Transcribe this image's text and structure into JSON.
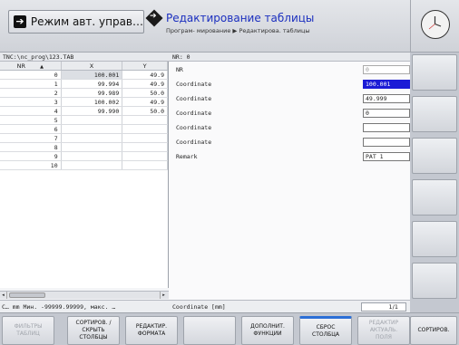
{
  "header": {
    "mode_title": "Режим авт. управ…",
    "edit_title": "Редактирование таблицы",
    "edit_breadcrumb": "Програм- мирование ▶ Редактирова. таблицы"
  },
  "table": {
    "path": "TNC:\\nc_prog\\123.TAB",
    "columns": [
      "NR",
      "X",
      "Y"
    ],
    "sort_indicator": "▲",
    "rows": [
      {
        "nr": "0",
        "x": "100.001",
        "y": "49.9"
      },
      {
        "nr": "1",
        "x": "99.994",
        "y": "49.9"
      },
      {
        "nr": "2",
        "x": "99.989",
        "y": "50.0"
      },
      {
        "nr": "3",
        "x": "100.002",
        "y": "49.9"
      },
      {
        "nr": "4",
        "x": "99.990",
        "y": "50.0"
      },
      {
        "nr": "5",
        "x": "",
        "y": ""
      },
      {
        "nr": "6",
        "x": "",
        "y": ""
      },
      {
        "nr": "7",
        "x": "",
        "y": ""
      },
      {
        "nr": "8",
        "x": "",
        "y": ""
      },
      {
        "nr": "9",
        "x": "",
        "y": ""
      },
      {
        "nr": "10",
        "x": "",
        "y": ""
      }
    ],
    "status": "C… mm Мин. -99999.99999, макс. …"
  },
  "form": {
    "header": "NR: 0",
    "fields": [
      {
        "label": "NR",
        "value": "0"
      },
      {
        "label": "Coordinate",
        "value": "100.001"
      },
      {
        "label": "Coordinate",
        "value": "49.999"
      },
      {
        "label": "Coordinate",
        "value": "0"
      },
      {
        "label": "Coordinate",
        "value": ""
      },
      {
        "label": "Coordinate",
        "value": ""
      },
      {
        "label": "Remark",
        "value": "PAT 1"
      }
    ],
    "status": "Coordinate [mm]",
    "page": "1/1"
  },
  "softkeys": [
    "ФИЛЬТРЫ\nТАБЛИЦ",
    "СОРТИРОВ. /\nСКРЫТЬ\nСТОЛБЦЫ",
    "РЕДАКТИР.\nФОРМАТА",
    "",
    "ДОПОЛНИТ.\nФУНКЦИИ",
    "СБРОС\nСТОЛБЦА",
    "РЕДАКТИР\nАКТУАЛЬ.\nПОЛЯ",
    "СОРТИРОВ."
  ]
}
